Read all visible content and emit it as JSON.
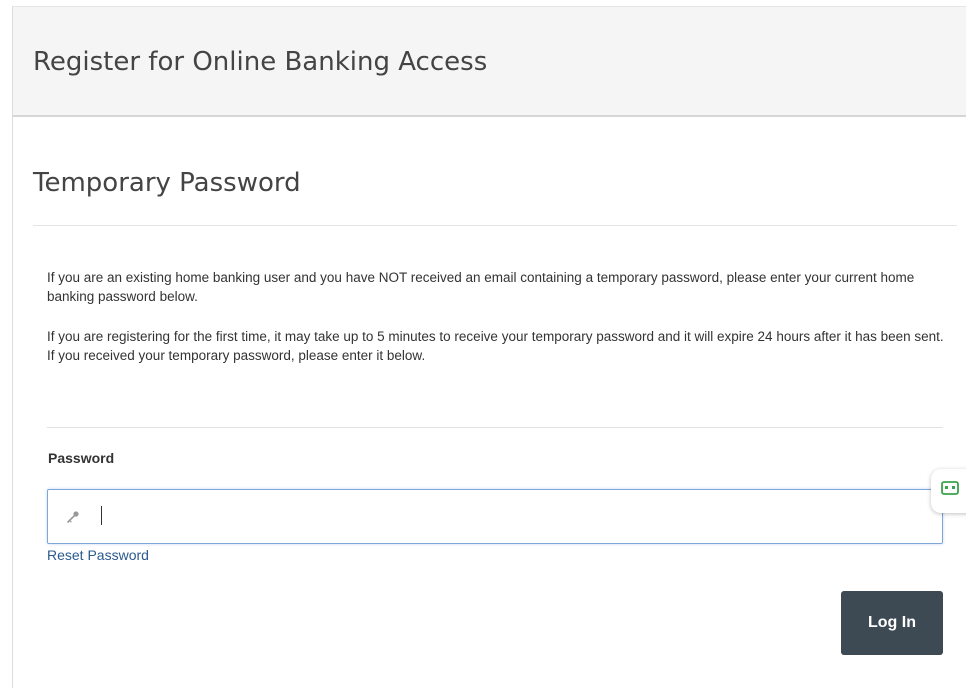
{
  "header": {
    "title": "Register for Online Banking Access"
  },
  "section": {
    "title": "Temporary Password"
  },
  "instructions": {
    "paragraph_1": "If you are an existing home banking user and you have NOT received an email containing a temporary password, please enter your current home banking password below.",
    "paragraph_2": "If you are registering for the first time, it may take up to 5 minutes to receive your temporary password and it will expire 24 hours after it has been sent. If you received your temporary password, please enter it below."
  },
  "form": {
    "password_label": "Password",
    "password_value": "",
    "password_icon": "key-icon",
    "reset_link_label": "Reset Password",
    "login_button_label": "Log In"
  },
  "widgets": {
    "password_manager_icon": "password-manager-icon"
  },
  "colors": {
    "button_bg": "#3d4a54",
    "link": "#2b5a8f",
    "input_focus_border": "#7ea6d9",
    "header_bg": "#f5f5f5",
    "widget_icon": "#3aa34a"
  }
}
